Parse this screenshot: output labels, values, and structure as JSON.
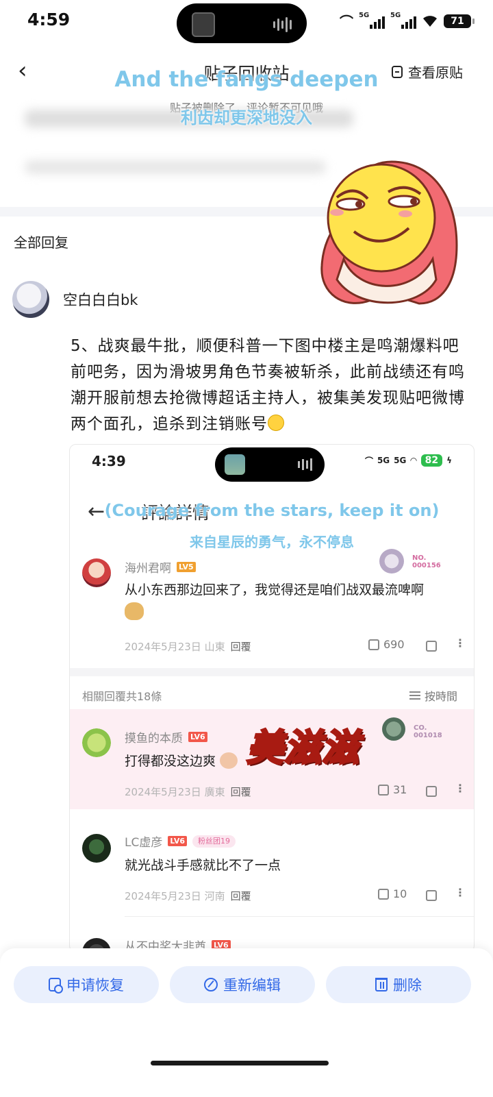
{
  "status_bar": {
    "time": "4:59",
    "network1": "5G",
    "network2": "5G",
    "battery": "71",
    "icons": [
      "earbuds-icon",
      "signal-icon",
      "wifi-icon",
      "battery-icon"
    ]
  },
  "header": {
    "title": "贴子回收站",
    "view_original": "查看原贴",
    "deleted_note": "贴子被删除了，评论暂不可见哦"
  },
  "captions": {
    "en": "And the fangs deepen",
    "cn": "利齿却更深地没入"
  },
  "comments_section": {
    "title": "全部回复"
  },
  "post": {
    "username": "空白白白bk",
    "text": "5、战爽最牛批，顺便科普一下图中楼主是鸣潮爆料吧前吧务，因为滑坡男角色节奏被斩杀，此前战绩还有鸣潮开服前想去抢微博超话主持人，被集美发现贴吧微博两个面孔，追杀到注销账号"
  },
  "embedded": {
    "status": {
      "time": "4:39",
      "network1": "5G",
      "network2": "5G",
      "battery": "82"
    },
    "title": "評論詳情",
    "caption_en": "(Courage from the stars, keep it on)",
    "caption_cn": "来自星辰的勇气，永不停息",
    "main_comment": {
      "name": "海州君啊",
      "level": "LV5",
      "badge": "NO. 000156",
      "text": "从小东西那边回来了，我觉得还是咱们战双最流啤啊",
      "date": "2024年5月23日 山東",
      "reply": "回覆",
      "likes": "690"
    },
    "replies_header": {
      "count": "相關回覆共18條",
      "sort": "按時間"
    },
    "replies": [
      {
        "name": "摸鱼的本质",
        "level": "LV6",
        "badge": "CO. 001018",
        "text": "打得都没这边爽",
        "date": "2024年5月23日 廣東",
        "reply": "回覆",
        "likes": "31"
      },
      {
        "name": "LC虚彦",
        "level": "LV6",
        "fan": "粉丝团19",
        "text": "就光战斗手感就比不了一点",
        "date": "2024年5月23日 河南",
        "reply": "回覆",
        "likes": "10"
      },
      {
        "name": "从不中奖大非酋",
        "level": "LV6"
      }
    ],
    "sticker_text": "美滋滋"
  },
  "actions": {
    "restore": "申请恢复",
    "reedit": "重新编辑",
    "delete": "删除",
    "accent": "#3369e7"
  }
}
